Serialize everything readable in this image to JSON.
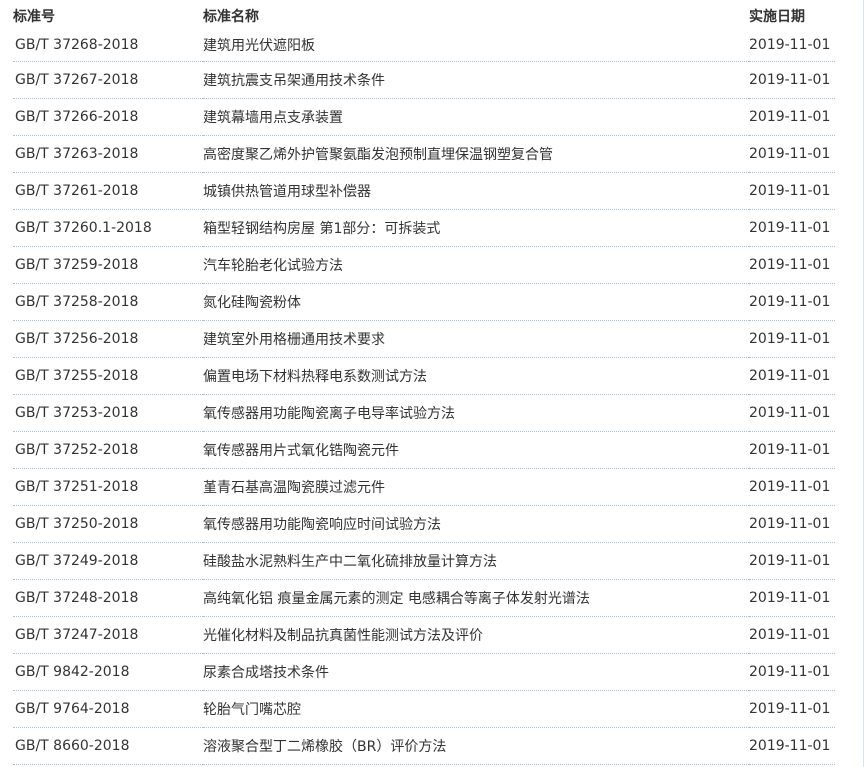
{
  "table": {
    "headers": {
      "code": "标准号",
      "name": "标准名称",
      "date": "实施日期"
    },
    "rows": [
      {
        "code": "GB/T 37268-2018",
        "name": "建筑用光伏遮阳板",
        "date": "2019-11-01"
      },
      {
        "code": "GB/T 37267-2018",
        "name": "建筑抗震支吊架通用技术条件",
        "date": "2019-11-01"
      },
      {
        "code": "GB/T 37266-2018",
        "name": "建筑幕墙用点支承装置",
        "date": "2019-11-01"
      },
      {
        "code": "GB/T 37263-2018",
        "name": "高密度聚乙烯外护管聚氨酯发泡预制直埋保温钢塑复合管",
        "date": "2019-11-01"
      },
      {
        "code": "GB/T 37261-2018",
        "name": "城镇供热管道用球型补偿器",
        "date": "2019-11-01"
      },
      {
        "code": "GB/T 37260.1-2018",
        "name": "箱型轻钢结构房屋 第1部分：可拆装式",
        "date": "2019-11-01"
      },
      {
        "code": "GB/T 37259-2018",
        "name": "汽车轮胎老化试验方法",
        "date": "2019-11-01"
      },
      {
        "code": "GB/T 37258-2018",
        "name": "氮化硅陶瓷粉体",
        "date": "2019-11-01"
      },
      {
        "code": "GB/T 37256-2018",
        "name": "建筑室外用格栅通用技术要求",
        "date": "2019-11-01"
      },
      {
        "code": "GB/T 37255-2018",
        "name": "偏置电场下材料热释电系数测试方法",
        "date": "2019-11-01"
      },
      {
        "code": "GB/T 37253-2018",
        "name": "氧传感器用功能陶瓷离子电导率试验方法",
        "date": "2019-11-01"
      },
      {
        "code": "GB/T 37252-2018",
        "name": "氧传感器用片式氧化锆陶瓷元件",
        "date": "2019-11-01"
      },
      {
        "code": "GB/T 37251-2018",
        "name": "堇青石基高温陶瓷膜过滤元件",
        "date": "2019-11-01"
      },
      {
        "code": "GB/T 37250-2018",
        "name": "氧传感器用功能陶瓷响应时间试验方法",
        "date": "2019-11-01"
      },
      {
        "code": "GB/T 37249-2018",
        "name": "硅酸盐水泥熟料生产中二氧化硫排放量计算方法",
        "date": "2019-11-01"
      },
      {
        "code": "GB/T 37248-2018",
        "name": "高纯氧化铝 痕量金属元素的测定 电感耦合等离子体发射光谱法",
        "date": "2019-11-01"
      },
      {
        "code": "GB/T 37247-2018",
        "name": "光催化材料及制品抗真菌性能测试方法及评价",
        "date": "2019-11-01"
      },
      {
        "code": "GB/T 9842-2018",
        "name": "尿素合成塔技术条件",
        "date": "2019-11-01"
      },
      {
        "code": "GB/T 9764-2018",
        "name": "轮胎气门嘴芯腔",
        "date": "2019-11-01"
      },
      {
        "code": "GB/T 8660-2018",
        "name": "溶液聚合型丁二烯橡胶（BR）评价方法",
        "date": "2019-11-01"
      }
    ]
  }
}
